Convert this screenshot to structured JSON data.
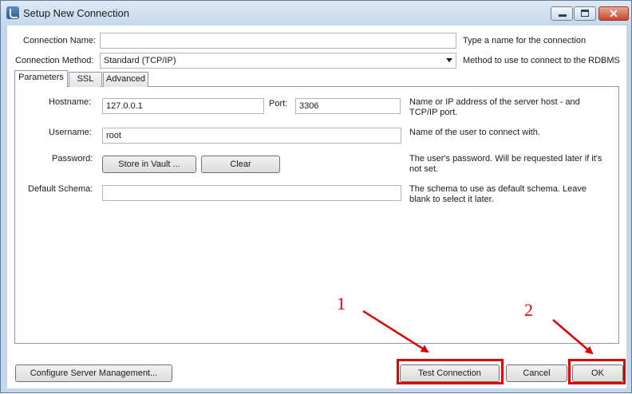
{
  "window": {
    "title": "Setup New Connection",
    "close_symbol": "✕"
  },
  "form": {
    "connection_name_label": "Connection Name:",
    "connection_name_value": "",
    "connection_name_hint": "Type a name for the connection",
    "connection_method_label": "Connection Method:",
    "connection_method_value": "Standard (TCP/IP)",
    "connection_method_hint": "Method to use to connect to the RDBMS"
  },
  "tabs": [
    {
      "label": "Parameters",
      "active": true
    },
    {
      "label": "SSL",
      "active": false
    },
    {
      "label": "Advanced",
      "active": false
    }
  ],
  "parameters": {
    "hostname_label": "Hostname:",
    "hostname_value": "127.0.0.1",
    "port_label": "Port:",
    "port_value": "3306",
    "hostname_hint": "Name or IP address of the server host - and TCP/IP port.",
    "username_label": "Username:",
    "username_value": "root",
    "username_hint": "Name of the user to connect with.",
    "password_label": "Password:",
    "store_in_vault_label": "Store in Vault ...",
    "clear_label": "Clear",
    "password_hint": "The user's password. Will be requested later if it's not set.",
    "default_schema_label": "Default Schema:",
    "default_schema_value": "",
    "default_schema_hint": "The schema to use as default schema. Leave blank to select it later."
  },
  "footer": {
    "configure_label": "Configure Server Management...",
    "test_connection_label": "Test Connection",
    "cancel_label": "Cancel",
    "ok_label": "OK"
  },
  "annotations": {
    "marker_1": "1",
    "marker_2": "2",
    "color": "#e00000"
  }
}
